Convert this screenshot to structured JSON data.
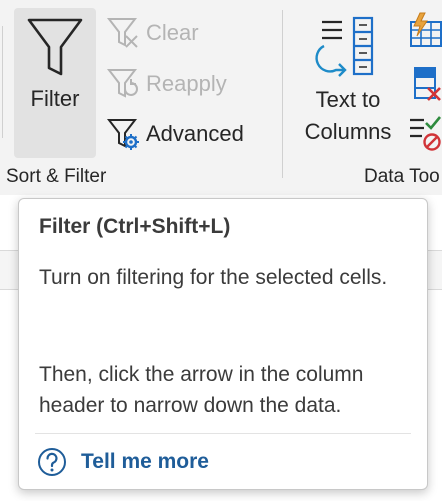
{
  "ribbon": {
    "sort_filter_group": {
      "filter_label": "Filter",
      "clear_label": "Clear",
      "reapply_label": "Reapply",
      "advanced_label": "Advanced",
      "group_label": "Sort & Filter"
    },
    "data_tools_group": {
      "text_to_columns_line1": "Text to",
      "text_to_columns_line2": "Columns",
      "group_label": "Data Too"
    }
  },
  "tooltip": {
    "title": "Filter (Ctrl+Shift+L)",
    "description": "Turn on filtering for the selected cells.",
    "instruction": "Then, click the arrow in the column header to narrow down the data.",
    "link_label": "Tell me more"
  },
  "colors": {
    "ribbon_bg": "#f3f3f3",
    "selected_button_bg": "#e2e2e2",
    "disabled_text": "#b4b4b4",
    "link": "#1f5d99",
    "icon_blue": "#1e6fc8",
    "icon_red": "#d13438",
    "icon_green": "#2e8b3e",
    "icon_orange": "#e8a33d"
  },
  "icons": [
    "funnel-icon",
    "clear-filter-icon",
    "reapply-icon",
    "advanced-filter-icon",
    "text-to-columns-icon",
    "flash-fill-icon",
    "remove-duplicates-icon",
    "data-validation-icon",
    "help-icon"
  ]
}
